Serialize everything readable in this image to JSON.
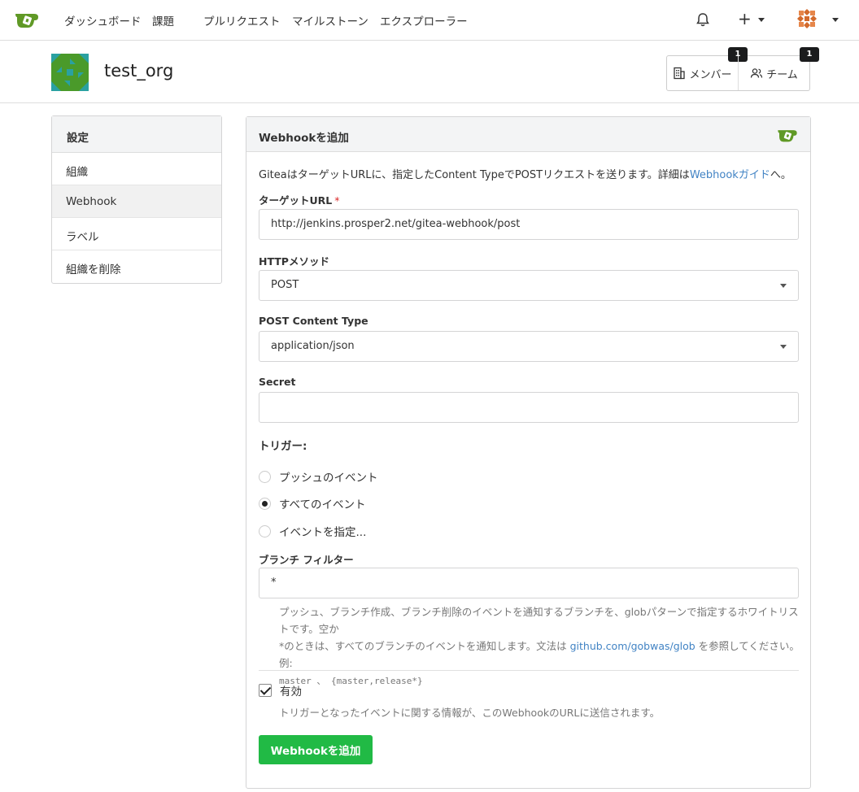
{
  "nav": {
    "items": [
      "ダッシュボード",
      "課題",
      "プルリクエスト",
      "マイルストーン",
      "エクスプローラー"
    ]
  },
  "org": {
    "name": "test_org",
    "members_label": "メンバー",
    "members_count": "1",
    "teams_label": "チーム",
    "teams_count": "1"
  },
  "sidebar": {
    "header": "設定",
    "items": [
      "組織",
      "Webhook",
      "ラベル",
      "組織を削除"
    ],
    "active_index": 1
  },
  "form": {
    "title": "Webhookを追加",
    "intro_prefix": "GiteaはターゲットURLに、指定したContent TypeでPOSTリクエストを送ります。詳細は",
    "intro_link": "Webhookガイド",
    "intro_suffix": "へ。",
    "target_url_label": "ターゲットURL",
    "required_mark": "*",
    "target_url_value": "http://jenkins.prosper2.net/gitea-webhook/post",
    "http_method_label": "HTTPメソッド",
    "http_method_value": "POST",
    "content_type_label": "POST Content Type",
    "content_type_value": "application/json",
    "secret_label": "Secret",
    "secret_value": "",
    "trigger_label": "トリガー:",
    "trigger_options": [
      "プッシュのイベント",
      "すべてのイベント",
      "イベントを指定..."
    ],
    "trigger_selected": 1,
    "branch_filter_label": "ブランチ フィルター",
    "branch_filter_value": "*",
    "branch_help_1": "プッシュ、ブランチ作成、ブランチ削除のイベントを通知するブランチを、globパターンで指定するホワイトリストです。空か",
    "branch_help_2_prefix": "*のときは、すべてのブランチのイベントを通知します。文法は ",
    "branch_help_link": "github.com/gobwas/glob",
    "branch_help_2_suffix": " を参照してください。例:",
    "branch_help_example": "master 、 {master,release*}",
    "active_label": "有効",
    "active_checked": true,
    "active_help": "トリガーとなったイベントに関する情報が、このWebhookのURLに送信されます。",
    "submit_label": "Webhookを追加"
  }
}
